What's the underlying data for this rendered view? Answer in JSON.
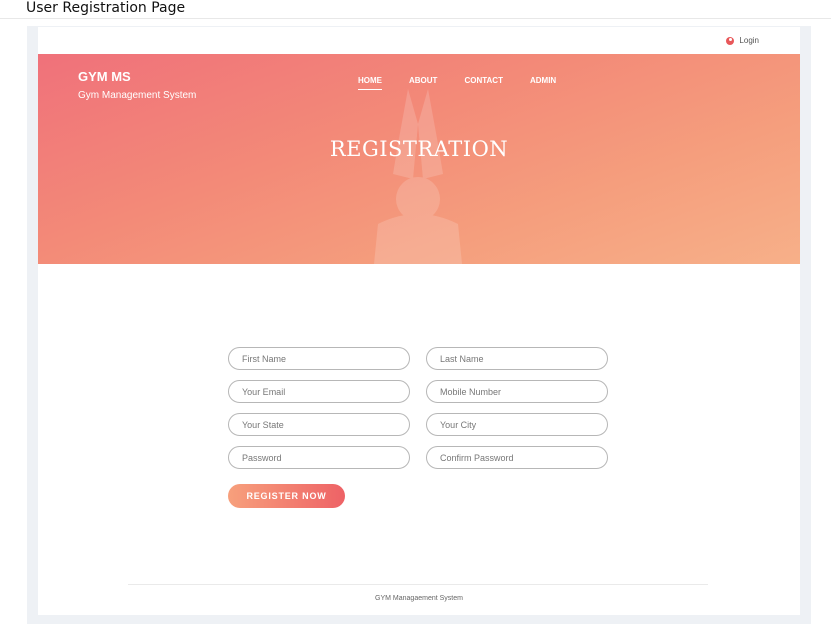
{
  "caption": "User Registration Page",
  "topbar": {
    "login_label": "Login"
  },
  "header": {
    "brand": "GYM MS",
    "tagline": "Gym Management System",
    "nav": [
      "HOME",
      "ABOUT",
      "CONTACT",
      "ADMIN"
    ],
    "title": "REGISTRATION"
  },
  "form": {
    "first_name": "First Name",
    "last_name": "Last Name",
    "email": "Your Email",
    "mobile": "Mobile Number",
    "state": "Your State",
    "city": "Your City",
    "password": "Password",
    "confirm_password": "Confirm Password",
    "submit_label": "REGISTER NOW"
  },
  "footer": {
    "text": "GYM Managaement System"
  },
  "colors": {
    "accent": "#ee6266",
    "hero_start": "#f0717a",
    "hero_end": "#f7b089"
  }
}
